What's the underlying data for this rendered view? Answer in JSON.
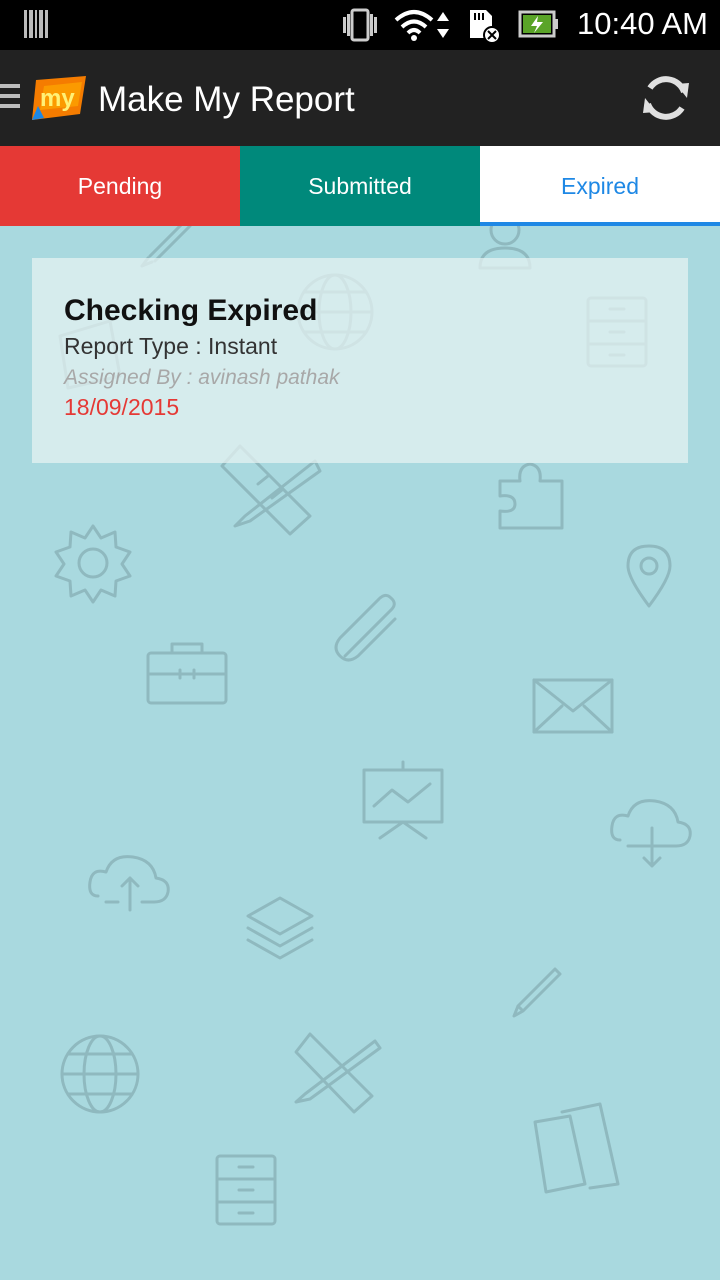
{
  "status_bar": {
    "time": "10:40 AM",
    "icons": [
      "barcode-icon",
      "vibrate-icon",
      "wifi-icon",
      "data-transfer-icon",
      "sd-card-error-icon",
      "battery-charging-icon"
    ]
  },
  "app_bar": {
    "logo_text": "my",
    "title": "Make My Report",
    "refresh_icon": "refresh-icon",
    "menu_icon": "hamburger-menu-icon"
  },
  "tabs": [
    {
      "label": "Pending",
      "color": "#e53935"
    },
    {
      "label": "Submitted",
      "color": "#00897b"
    },
    {
      "label": "Expired",
      "color": "#1e88e5",
      "selected": true
    }
  ],
  "reports": [
    {
      "title": "Checking Expired",
      "type": "Report Type : Instant",
      "assigned_by": "Assigned By : avinash pathak",
      "date": "18/09/2015",
      "date_color": "#e53935"
    }
  ],
  "background_icons": [
    "pencil-icon",
    "user-icon",
    "globe-icon",
    "filing-cabinet-icon",
    "ruler-pencil-icon",
    "puzzle-icon",
    "gear-icon",
    "location-pin-icon",
    "paperclip-icon",
    "briefcase-icon",
    "envelope-icon",
    "presentation-chart-icon",
    "cloud-upload-icon",
    "cloud-download-icon",
    "layers-icon",
    "documents-icon"
  ]
}
